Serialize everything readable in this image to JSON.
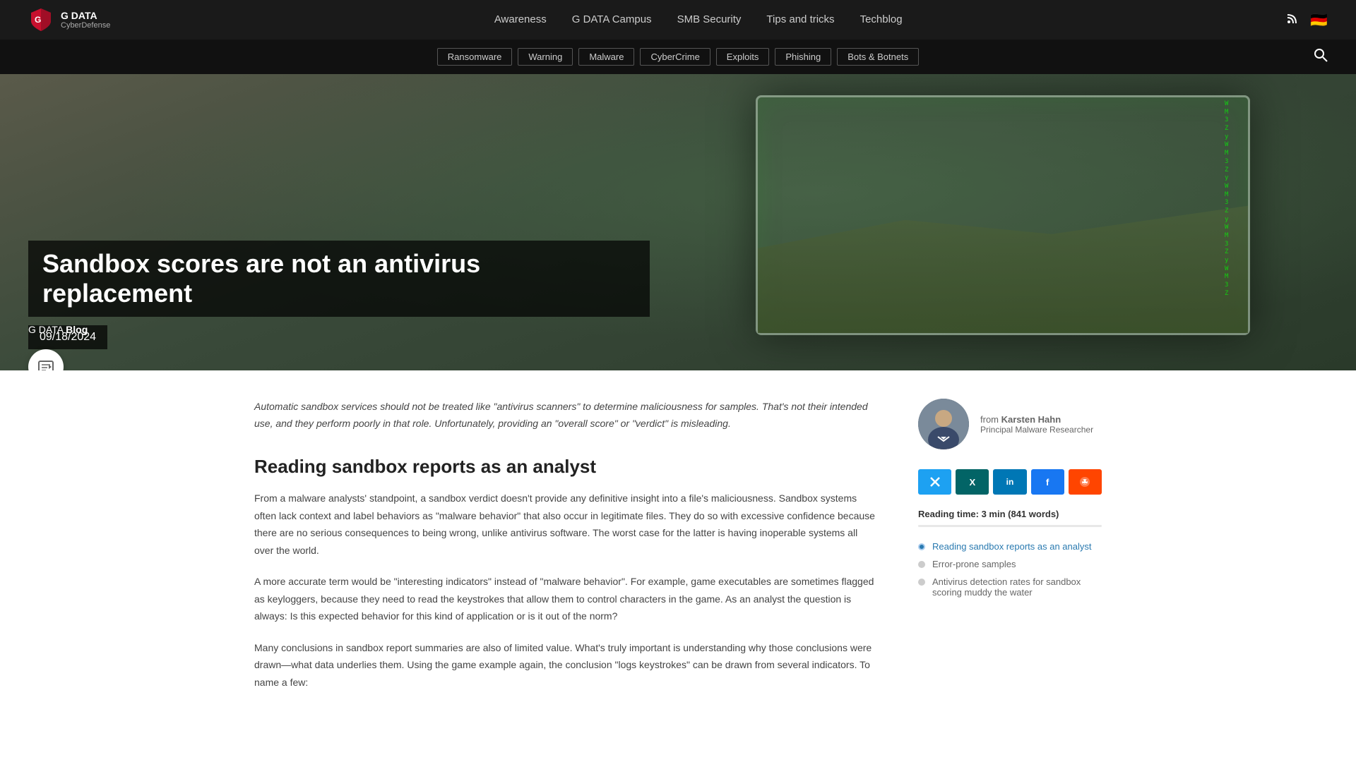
{
  "site": {
    "logo_text": "G DATA",
    "logo_sub": "CyberDefense"
  },
  "nav": {
    "items": [
      {
        "label": "Awareness",
        "href": "#"
      },
      {
        "label": "G DATA Campus",
        "href": "#"
      },
      {
        "label": "SMB Security",
        "href": "#"
      },
      {
        "label": "Tips and tricks",
        "href": "#"
      },
      {
        "label": "Techblog",
        "href": "#"
      }
    ]
  },
  "tags": {
    "items": [
      {
        "label": "Ransomware"
      },
      {
        "label": "Warning"
      },
      {
        "label": "Malware"
      },
      {
        "label": "CyberCrime"
      },
      {
        "label": "Exploits"
      },
      {
        "label": "Phishing"
      },
      {
        "label": "Bots & Botnets"
      }
    ]
  },
  "hero": {
    "title": "Sandbox scores are not an antivirus replacement",
    "date": "09/18/2024",
    "blog_label": "G DATA Blog"
  },
  "article": {
    "intro": "Automatic sandbox services should not be treated like \"antivirus scanners\" to determine maliciousness for samples. That's not their intended use, and they perform poorly in that role. Unfortunately, providing an \"overall score\" or \"verdict\" is misleading.",
    "section1_title": "Reading sandbox reports as an analyst",
    "paragraph1": "From a malware analysts' standpoint, a sandbox verdict doesn't provide any definitive insight into a file's maliciousness. Sandbox systems often lack context and label behaviors as \"malware behavior\" that also occur in legitimate files. They do so with excessive confidence because there are no serious consequences to being wrong, unlike antivirus software. The worst case for the latter is having inoperable systems all over the world.",
    "paragraph2": "A more accurate term would be \"interesting indicators\" instead of \"malware behavior\". For example, game executables are sometimes flagged as keyloggers, because they need to read the keystrokes that allow them to control characters in the game. As an analyst the question is always: Is this expected behavior for this kind of application or is it out of the norm?",
    "paragraph3": "Many conclusions in sandbox report summaries are also of limited value. What's truly important is understanding why those conclusions were drawn—what data underlies them. Using the game example again, the conclusion \"logs keystrokes\" can be drawn from several indicators. To name a few:"
  },
  "author": {
    "from_label": "from Karsten Hahn",
    "name": "Karsten Hahn",
    "role": "Principal Malware Researcher"
  },
  "share": {
    "twitter_label": "𝕏",
    "xing_label": "X",
    "linkedin_label": "in",
    "facebook_label": "f",
    "reddit_label": "●"
  },
  "reading": {
    "time_label": "Reading time: 3 min (841 words)"
  },
  "toc": {
    "items": [
      {
        "label": "Reading sandbox reports as an analyst",
        "active": true
      },
      {
        "label": "Error-prone samples",
        "active": false
      },
      {
        "label": "Antivirus detection rates for sandbox scoring muddy the water",
        "active": false
      }
    ]
  }
}
